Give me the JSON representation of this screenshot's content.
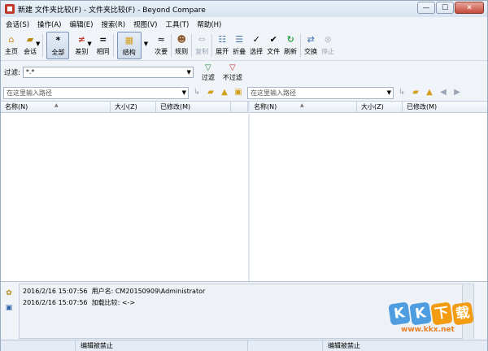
{
  "window": {
    "title": "新建 文件夹比较(F) - 文件夹比较(F) - Beyond Compare",
    "controls": [
      "—",
      "☐",
      "✕"
    ]
  },
  "menu": [
    "会话(S)",
    "操作(A)",
    "编辑(E)",
    "搜索(R)",
    "视图(V)",
    "工具(T)",
    "帮助(H)"
  ],
  "toolbar": {
    "home": "主页",
    "session": "会话",
    "all": "全部",
    "diffs": "差别",
    "same": "相同",
    "structure": "结构",
    "minor": "次要",
    "rules": "规则",
    "copy": "复制",
    "expand": "展开",
    "collapse": "折叠",
    "select": "选择",
    "files": "文件",
    "refresh": "刷新",
    "swap": "交换",
    "stop": "停止"
  },
  "filter": {
    "label": "过滤:",
    "value": "*.*",
    "filter_btn": "过滤",
    "nofilter_btn": "不过滤"
  },
  "paths": {
    "left_placeholder": "在这里输入路径",
    "right_placeholder": "在这里输入路径"
  },
  "columns": {
    "left": [
      "名称(N)",
      "大小(Z)",
      "已修改(M)"
    ],
    "right": [
      "名称(N)",
      "大小(Z)",
      "已修改(M)"
    ]
  },
  "log": [
    {
      "time": "2016/2/16 15:07:56",
      "text": "用户名: CM20150909\\Administrator"
    },
    {
      "time": "2016/2/16 15:07:56",
      "text": "加载比较: <->"
    }
  ],
  "status": {
    "left": "编辑被禁止",
    "right": "编辑被禁止"
  },
  "watermark": {
    "letters": [
      "K",
      "K",
      "下",
      "载"
    ],
    "url": "www.kkx.net"
  }
}
